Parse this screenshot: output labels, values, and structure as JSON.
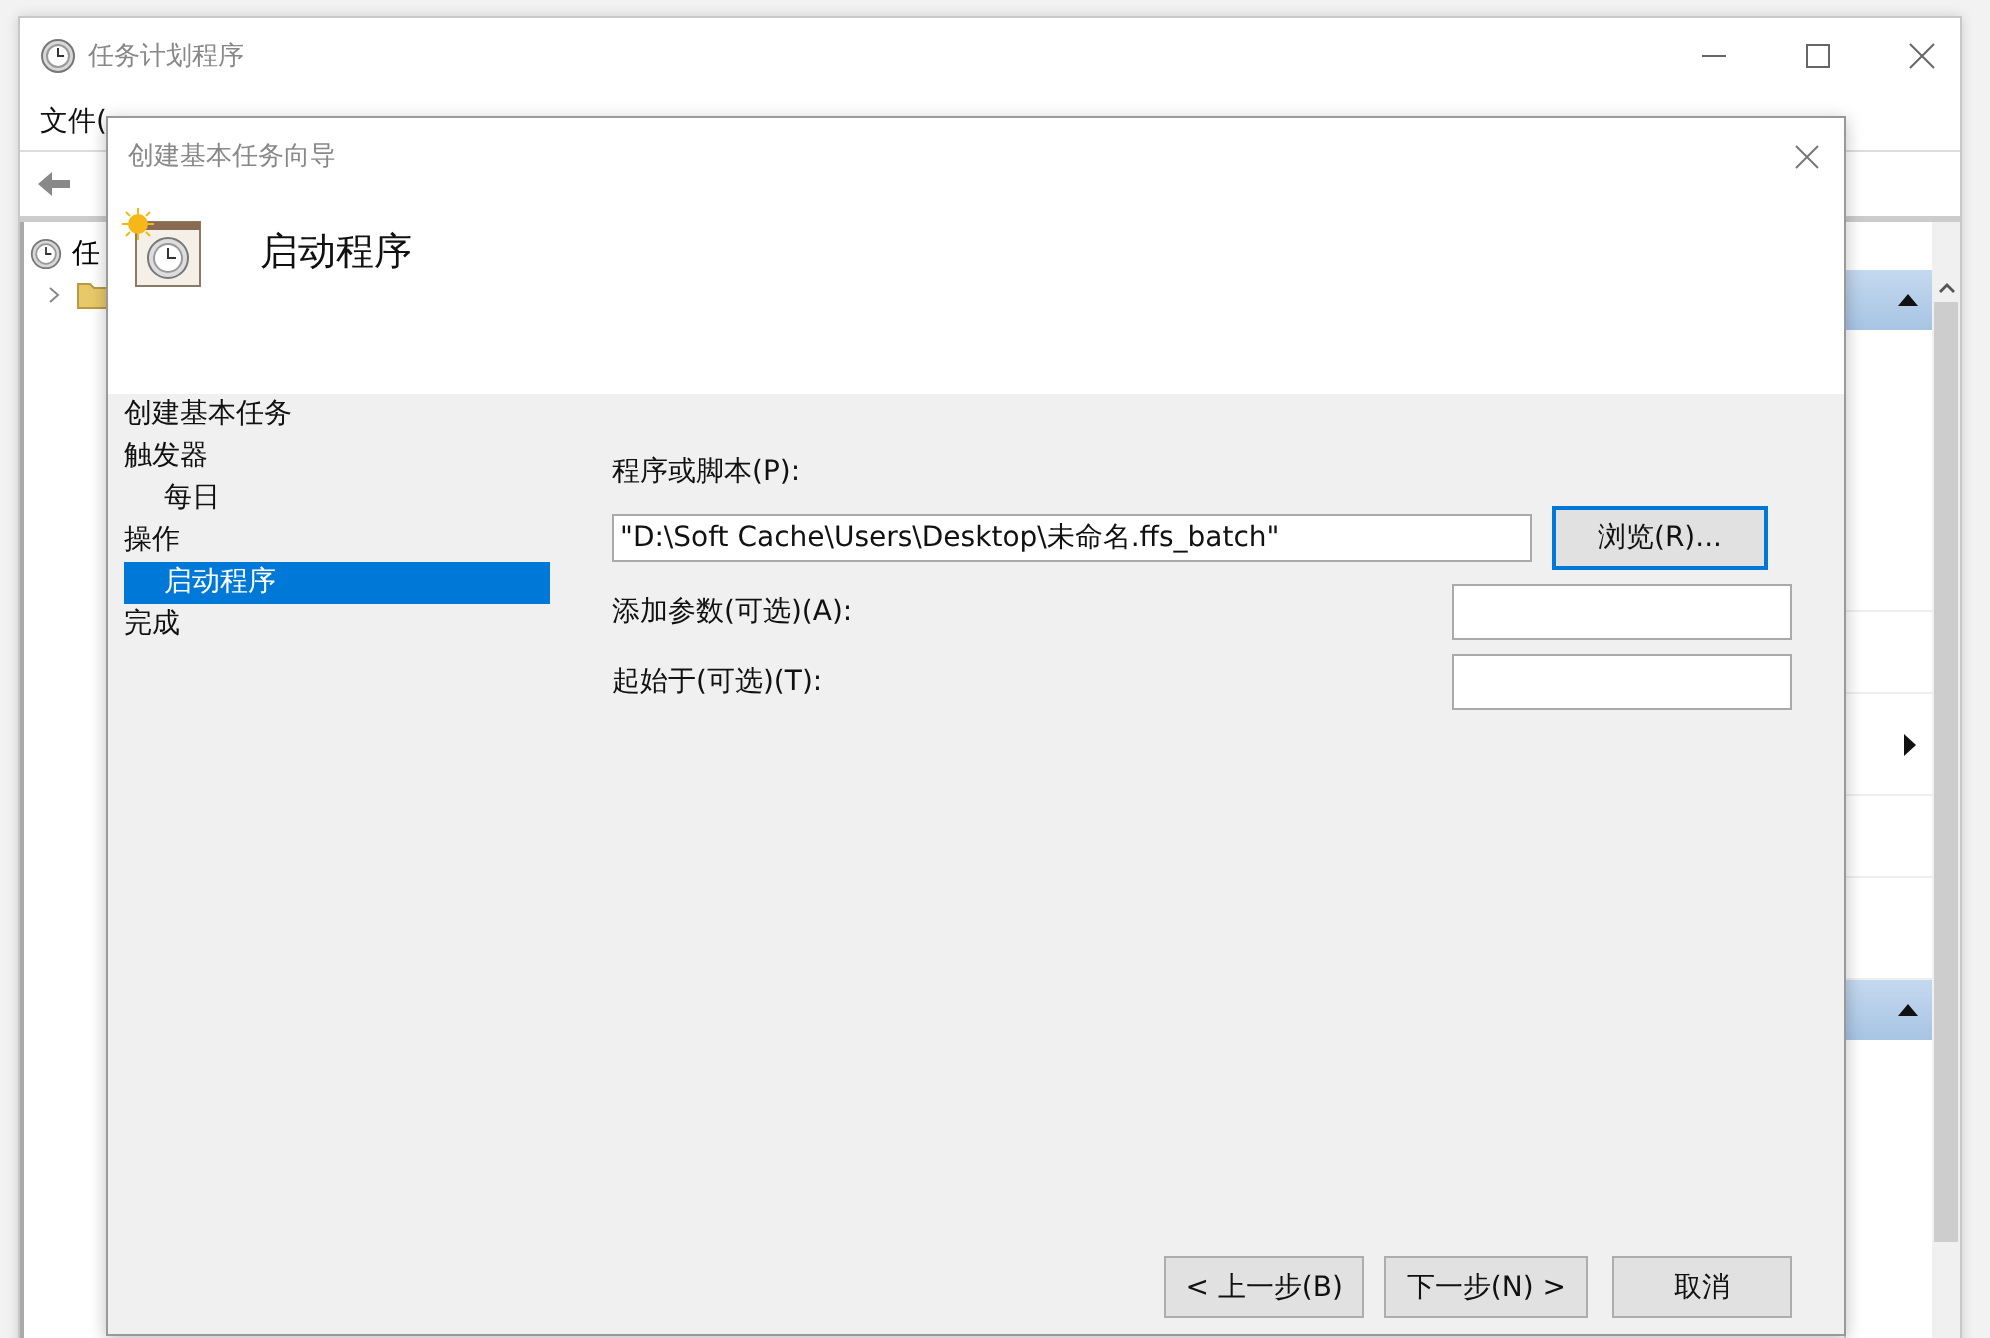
{
  "main_window": {
    "title": "任务计划程序",
    "menu": [
      {
        "label": "文件("
      }
    ],
    "tree": [
      {
        "label": "任"
      }
    ]
  },
  "dialog": {
    "title": "创建基本任务向导",
    "heading": "启动程序",
    "steps": [
      {
        "label": "创建基本任务",
        "selected": false
      },
      {
        "label": "触发器",
        "selected": false,
        "children": [
          {
            "label": "每日",
            "selected": false
          }
        ]
      },
      {
        "label": "操作",
        "selected": false,
        "children": [
          {
            "label": "启动程序",
            "selected": true
          }
        ]
      },
      {
        "label": "完成",
        "selected": false
      }
    ],
    "program": {
      "label": "程序或脚本(P):",
      "value": "\"D:\\Soft Cache\\Users\\Desktop\\未命名.ffs_batch\"",
      "browse": {
        "label": "浏览(R)...",
        "focused": true
      }
    },
    "options": [
      {
        "label": "添加参数(可选)(A):"
      },
      {
        "label": "起始于(可选)(T):"
      }
    ],
    "buttons": [
      {
        "label": "< 上一步(B)"
      },
      {
        "label": "下一步(N) >"
      },
      {
        "label": "取消"
      }
    ]
  }
}
